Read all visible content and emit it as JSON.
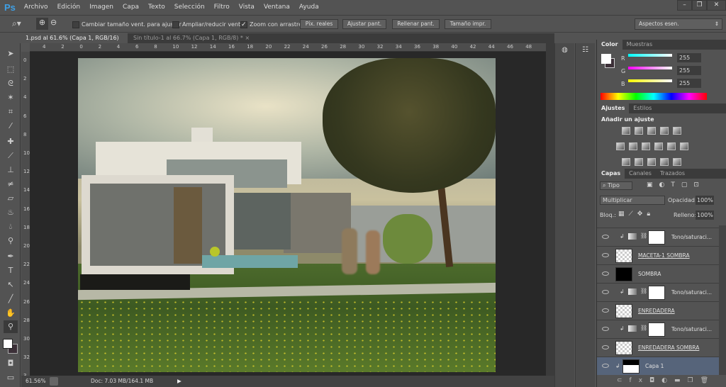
{
  "app": {
    "logo": "Ps"
  },
  "menu": [
    "Archivo",
    "Edición",
    "Imagen",
    "Capa",
    "Texto",
    "Selección",
    "Filtro",
    "Vista",
    "Ventana",
    "Ayuda"
  ],
  "window_controls": {
    "minimize": "–",
    "restore": "❐",
    "close": "✕"
  },
  "options": {
    "resize_windows_label": "Cambiar tamaño vent. para ajustar",
    "resize_windows_checked": false,
    "zoom_all_label": "Ampliar/reducir vent.",
    "zoom_all_checked": false,
    "scrubby_label": "Zoom con arrastre",
    "scrubby_checked": true,
    "buttons": [
      "Píx. reales",
      "Ajustar pant.",
      "Rellenar pant.",
      "Tamaño impr."
    ],
    "workspace": "Aspectos esen."
  },
  "tabs": [
    {
      "label": "1.psd al 61.6% (Capa 1, RGB/16) *",
      "active": true
    },
    {
      "label": "Sin título-1 al 66.7% (Capa 1, RGB/8) *",
      "active": false
    }
  ],
  "ruler_top": [
    "4",
    "2",
    "0",
    "2",
    "4",
    "6",
    "8",
    "10",
    "12",
    "14",
    "16",
    "18",
    "20",
    "22",
    "24",
    "26",
    "28",
    "30",
    "32",
    "34",
    "36",
    "38",
    "40",
    "42",
    "44",
    "46",
    "48"
  ],
  "ruler_left": [
    "0",
    "2",
    "4",
    "6",
    "8",
    "10",
    "12",
    "14",
    "16",
    "18",
    "20",
    "22",
    "24",
    "26",
    "28",
    "30",
    "32",
    "3"
  ],
  "status": {
    "zoom": "61.56%",
    "doc": "Doc: 7.03 MB/164.1 MB"
  },
  "color_panel": {
    "tabs": [
      "Color",
      "Muestras"
    ],
    "r": "255",
    "g": "255",
    "b": "255",
    "r_label": "R",
    "g_label": "G",
    "b_label": "B",
    "foreground": "#ffffff",
    "background": "#3c3038"
  },
  "adjust_panel": {
    "tabs": [
      "Ajustes",
      "Estilos"
    ],
    "heading": "Añadir un ajuste"
  },
  "layers_panel": {
    "tabs": [
      "Capas",
      "Canales",
      "Trazados"
    ],
    "filter": "Tipo",
    "blend_mode": "Multiplicar",
    "opacity_label": "Opacidad:",
    "opacity": "100%",
    "lock_label": "Bloq.:",
    "fill_label": "Relleno:",
    "fill": "100%",
    "layers": [
      {
        "name": "Tono/saturaci...",
        "type": "adjustment",
        "underline": false
      },
      {
        "name": "MACETA-1 SOMBRA",
        "type": "transparent",
        "underline": true
      },
      {
        "name": "SOMBRA",
        "type": "black",
        "underline": false
      },
      {
        "name": "Tono/saturaci...",
        "type": "adjustment",
        "underline": false
      },
      {
        "name": "ENREDADERA",
        "type": "transparent",
        "underline": true
      },
      {
        "name": "Tono/saturaci...",
        "type": "adjustment",
        "underline": false
      },
      {
        "name": "ENREDADERA SOMBRA",
        "type": "transparent",
        "underline": true
      },
      {
        "name": "Capa 1",
        "type": "image",
        "underline": false,
        "selected": true
      }
    ]
  }
}
